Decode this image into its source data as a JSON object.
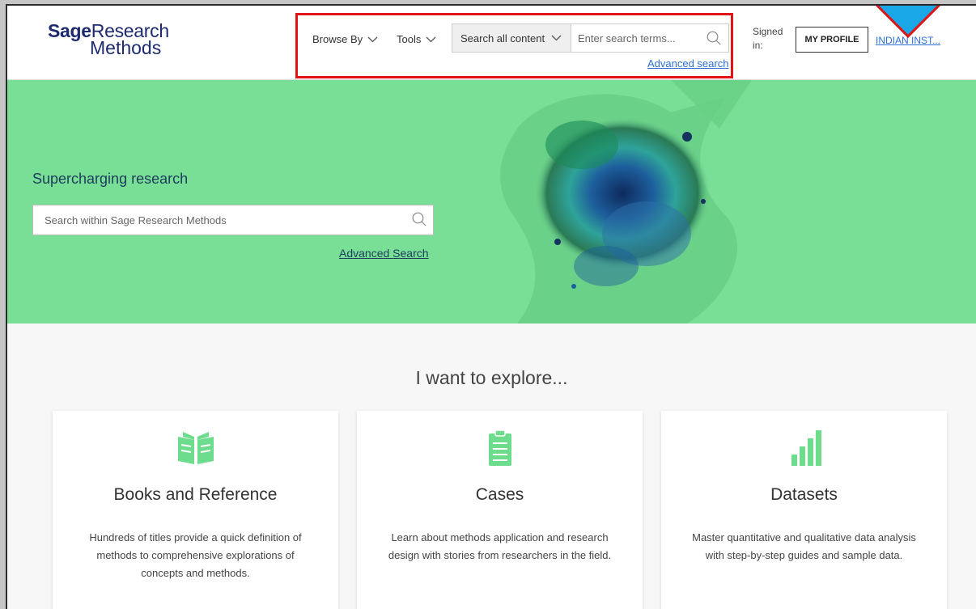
{
  "header": {
    "logo": {
      "brand": "Sage",
      "line1_rest": "Research",
      "line2": "Methods"
    },
    "nav": {
      "browse_by": "Browse By",
      "tools": "Tools"
    },
    "search": {
      "scope_selected": "Search all content",
      "placeholder": "Enter search terms...",
      "advanced_link": "Advanced search"
    },
    "signed_in_line1": "Signed",
    "signed_in_line2": "in:",
    "profile_button": "MY PROFILE",
    "institution_link": "INDIAN INST..."
  },
  "hero": {
    "title": "Supercharging research",
    "search_placeholder": "Search within Sage Research Methods",
    "advanced_link": "Advanced Search"
  },
  "explore": {
    "title": "I want to explore...",
    "cards": [
      {
        "title": "Books and Reference",
        "icon": "open-book-icon",
        "description": "Hundreds of titles provide a quick definition of methods to comprehensive explorations of concepts and methods."
      },
      {
        "title": "Cases",
        "icon": "clipboard-icon",
        "description": "Learn about methods application and research design with stories from researchers in the field."
      },
      {
        "title": "Datasets",
        "icon": "bar-chart-icon",
        "description": "Master quantitative and qualitative data analysis with step-by-step guides and sample data."
      }
    ]
  },
  "colors": {
    "brand_navy": "#1e2a6e",
    "hero_green": "#79df97",
    "icon_green": "#6ddc8c",
    "link_blue": "#2c6fd6",
    "highlight_red": "#e01414",
    "pointer_blue": "#1aa7e8"
  }
}
